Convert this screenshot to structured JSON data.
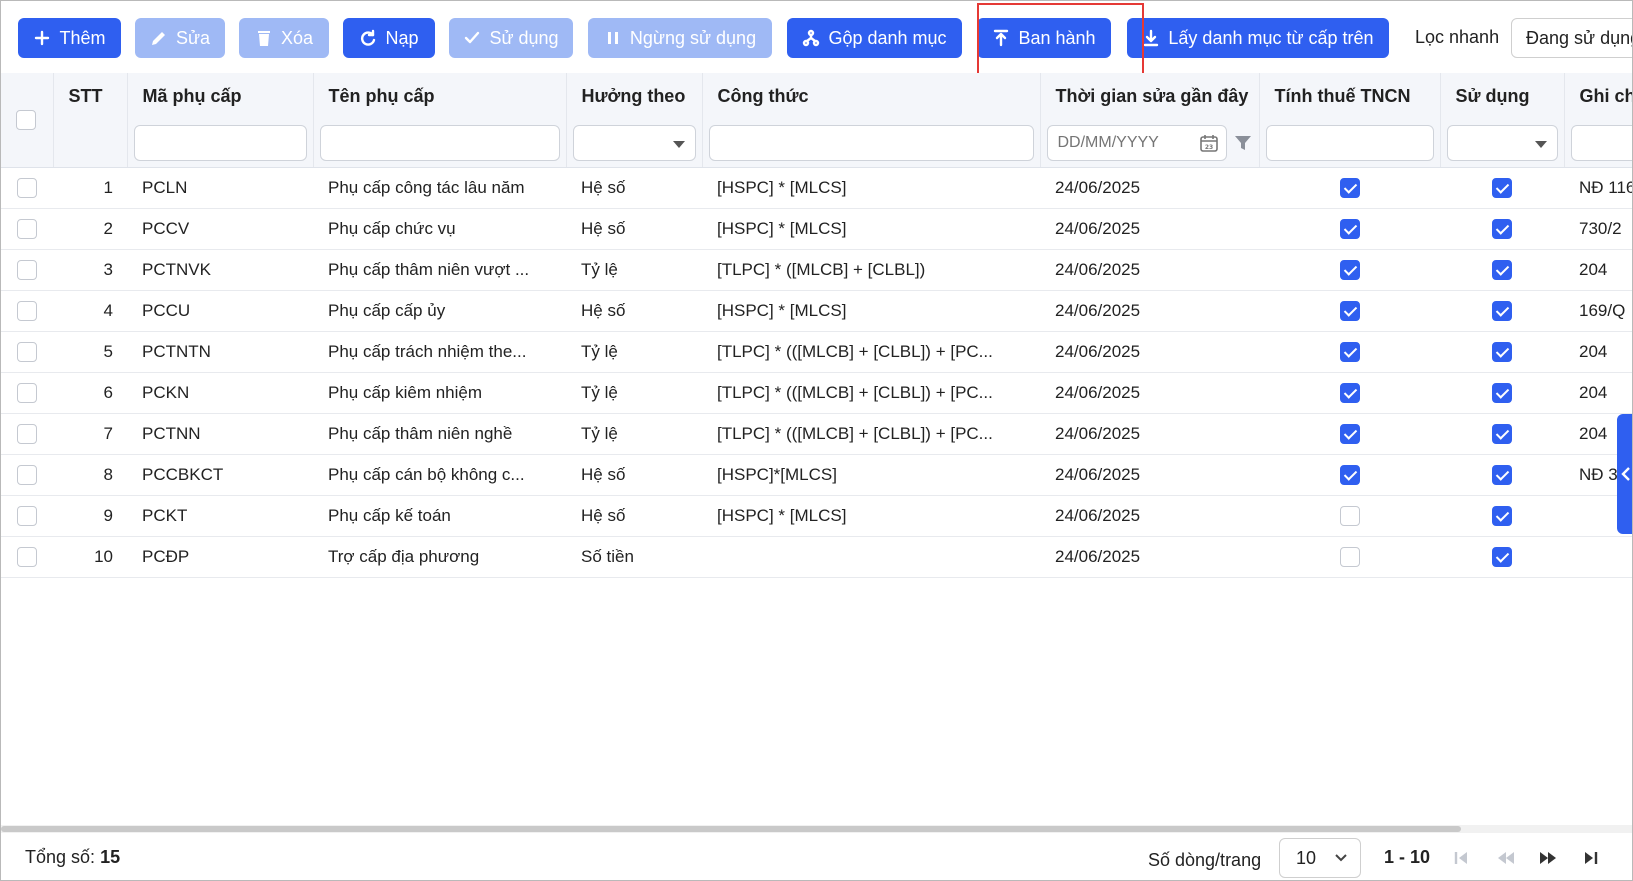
{
  "toolbar": {
    "buttons": [
      {
        "label": "Thêm",
        "icon": "plus-icon",
        "state": "enabled"
      },
      {
        "label": "Sửa",
        "icon": "pencil-icon",
        "state": "disabled"
      },
      {
        "label": "Xóa",
        "icon": "trash-icon",
        "state": "disabled"
      },
      {
        "label": "Nạp",
        "icon": "refresh-icon",
        "state": "enabled"
      },
      {
        "label": "Sử dụng",
        "icon": "check-icon",
        "state": "disabled"
      },
      {
        "label": "Ngừng sử dụng",
        "icon": "pause-icon",
        "state": "disabled"
      },
      {
        "label": "Gộp danh mục",
        "icon": "merge-icon",
        "state": "enabled"
      },
      {
        "label": "Ban hành",
        "icon": "upload-icon",
        "state": "enabled",
        "highlighted": true
      },
      {
        "label": "Lấy danh mục từ cấp trên",
        "icon": "download-icon",
        "state": "enabled"
      }
    ],
    "quick_filter_label": "Lọc nhanh",
    "quick_filter_value": "Đang sử dụng"
  },
  "table": {
    "columns": [
      "STT",
      "Mã phụ cấp",
      "Tên phụ cấp",
      "Hưởng theo",
      "Công thức",
      "Thời gian sửa gần đây",
      "Tính thuế TNCN",
      "Sử dụng",
      "Ghi chú"
    ],
    "date_placeholder": "DD/MM/YYYY",
    "rows": [
      {
        "stt": "1",
        "code": "PCLN",
        "name": "Phụ cấp công tác lâu năm",
        "basis": "Hệ số",
        "formula": "[HSPC] * [MLCS]",
        "modified": "24/06/2025",
        "tax": true,
        "used": true,
        "note": "NĐ 116"
      },
      {
        "stt": "2",
        "code": "PCCV",
        "name": "Phụ cấp chức vụ",
        "basis": "Hệ số",
        "formula": "[HSPC] * [MLCS]",
        "modified": "24/06/2025",
        "tax": true,
        "used": true,
        "note": "730/2"
      },
      {
        "stt": "3",
        "code": "PCTNVK",
        "name": "Phụ cấp thâm niên vượt ...",
        "basis": "Tỷ lệ",
        "formula": "[TLPC] * ([MLCB] + [CLBL])",
        "modified": "24/06/2025",
        "tax": true,
        "used": true,
        "note": "204"
      },
      {
        "stt": "4",
        "code": "PCCU",
        "name": "Phụ cấp cấp ủy",
        "basis": "Hệ số",
        "formula": "[HSPC] * [MLCS]",
        "modified": "24/06/2025",
        "tax": true,
        "used": true,
        "note": "169/Q"
      },
      {
        "stt": "5",
        "code": "PCTNTN",
        "name": "Phụ cấp trách nhiệm the...",
        "basis": "Tỷ lệ",
        "formula": "[TLPC] * (([MLCB] + [CLBL]) + [PC...",
        "modified": "24/06/2025",
        "tax": true,
        "used": true,
        "note": "204"
      },
      {
        "stt": "6",
        "code": "PCKN",
        "name": "Phụ cấp kiêm nhiệm",
        "basis": "Tỷ lệ",
        "formula": "[TLPC] * (([MLCB] + [CLBL]) + [PC...",
        "modified": "24/06/2025",
        "tax": true,
        "used": true,
        "note": "204"
      },
      {
        "stt": "7",
        "code": "PCTNN",
        "name": "Phụ cấp thâm niên nghề",
        "basis": "Tỷ lệ",
        "formula": "[TLPC] * (([MLCB] + [CLBL]) + [PC...",
        "modified": "24/06/2025",
        "tax": true,
        "used": true,
        "note": "204"
      },
      {
        "stt": "8",
        "code": "PCCBKCT",
        "name": "Phụ cấp cán bộ không c...",
        "basis": "Hệ số",
        "formula": "[HSPC]*[MLCS]",
        "modified": "24/06/2025",
        "tax": true,
        "used": true,
        "note": "NĐ 3"
      },
      {
        "stt": "9",
        "code": "PCKT",
        "name": "Phụ cấp kế toán",
        "basis": "Hệ số",
        "formula": "[HSPC] * [MLCS]",
        "modified": "24/06/2025",
        "tax": false,
        "used": true,
        "note": ""
      },
      {
        "stt": "10",
        "code": "PCĐP",
        "name": "Trợ cấp địa phương",
        "basis": "Số tiền",
        "formula": "",
        "modified": "24/06/2025",
        "tax": false,
        "used": true,
        "note": ""
      }
    ]
  },
  "footer": {
    "total_label": "Tổng số:",
    "total_value": "15",
    "rows_per_page_label": "Số dòng/trang",
    "rows_per_page_value": "10",
    "range": "1 - 10"
  },
  "colors": {
    "primary": "#2f5ff0",
    "disabled": "#9fb9f5",
    "highlight": "#e53935"
  }
}
